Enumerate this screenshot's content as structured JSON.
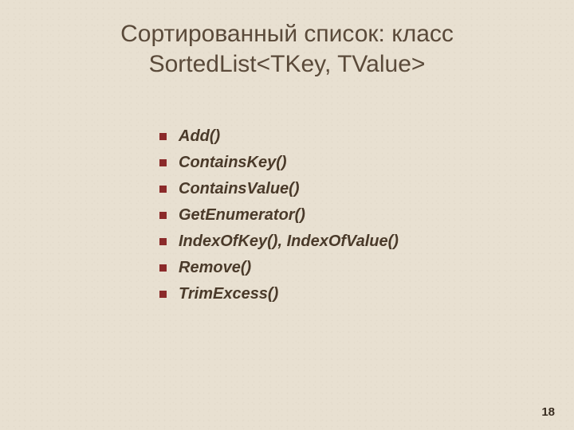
{
  "title": "Сортированный список: класс SortedList<TKey, TValue>",
  "items": [
    "Add()",
    "ContainsKey()",
    "ContainsValue()",
    "GetEnumerator()",
    "IndexOfKey(), IndexOfValue()",
    "Remove()",
    "TrimExcess()"
  ],
  "pageNumber": "18"
}
